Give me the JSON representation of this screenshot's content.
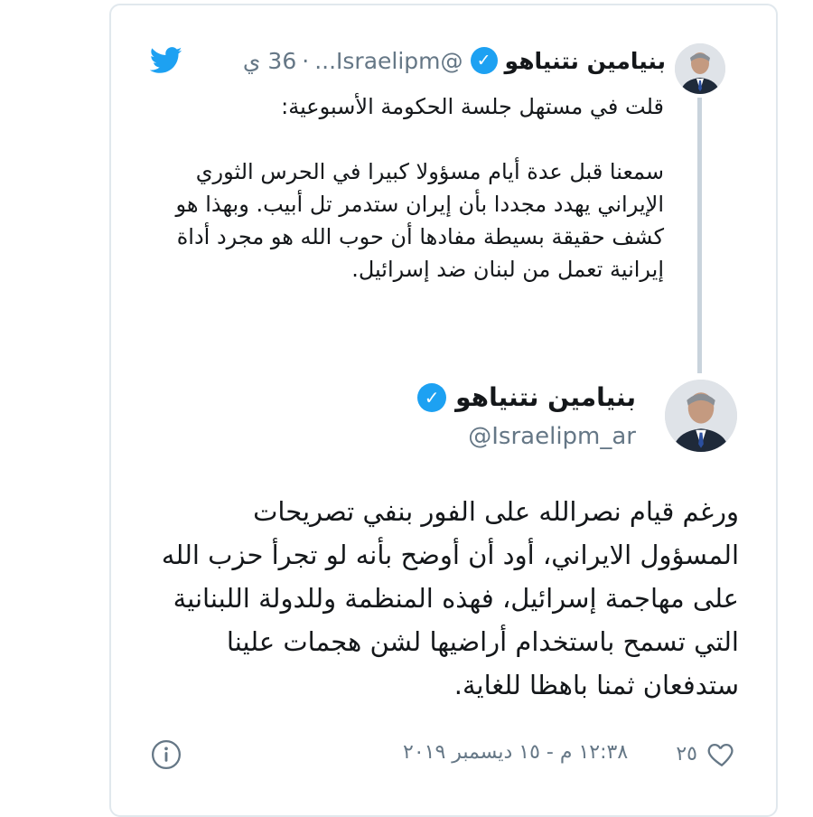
{
  "parent_tweet": {
    "author_name": "بنيامين نتنياهو",
    "handle": "@Israelipm...",
    "separator": "·",
    "time_ago": "36 ي",
    "verified_icon": "verified-badge-icon",
    "brand_icon": "twitter-bird-icon",
    "avatar": "author-avatar",
    "text_intro": "قلت في مستهل جلسة الحكومة الأسبوعية:",
    "text_body": "سمعنا قبل عدة أيام مسؤولا كبيرا في الحرس الثوري الإيراني يهدد مجددا بأن إيران ستدمر تل أبيب. وبهذا هو كشف حقيقة بسيطة مفادها أن حوب الله هو مجرد أداة إيرانية تعمل من لبنان ضد إسرائيل."
  },
  "main_tweet": {
    "author_name": "بنيامين نتنياهو",
    "handle": "@Israelipm_ar",
    "verified_icon": "verified-badge-icon",
    "avatar": "author-avatar",
    "text": "ورغم قيام نصرالله على الفور بنفي تصريحات المسؤول الايراني، أود أن أوضح بأنه لو تجرأ حزب الله على مهاجمة إسرائيل، فهذه المنظمة وللدولة اللبنانية التي تسمح باستخدام أراضيها لشن هجمات علينا ستدفعان ثمنا باهظا للغاية."
  },
  "footer": {
    "likes_count": "٢٥",
    "like_icon": "heart-icon",
    "timestamp": "١٢:٣٨ م - ١٥ ديسمبر ٢٠١٩",
    "info_icon": "info-icon"
  },
  "colors": {
    "twitter_blue": "#1da1f2",
    "text_primary": "#14171a",
    "text_secondary": "#657786",
    "border": "#e1e8ed"
  }
}
